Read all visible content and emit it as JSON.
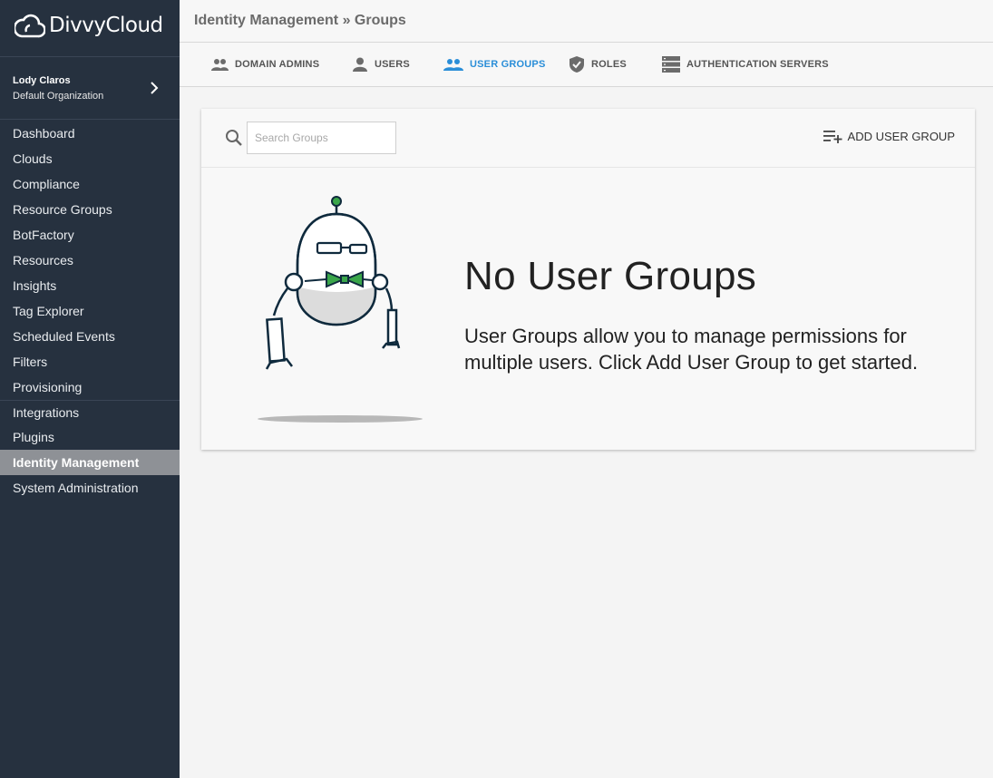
{
  "brand": {
    "name": "DivvyCloud"
  },
  "user": {
    "name": "Lody Claros",
    "org": "Default Organization"
  },
  "nav": {
    "items": [
      {
        "label": "Dashboard"
      },
      {
        "label": "Clouds"
      },
      {
        "label": "Compliance"
      },
      {
        "label": "Resource Groups"
      },
      {
        "label": "BotFactory"
      },
      {
        "label": "Resources"
      },
      {
        "label": "Insights"
      },
      {
        "label": "Tag Explorer"
      },
      {
        "label": "Scheduled Events"
      },
      {
        "label": "Filters"
      },
      {
        "label": "Provisioning"
      },
      {
        "label": "Integrations"
      },
      {
        "label": "Plugins"
      },
      {
        "label": "Identity Management"
      },
      {
        "label": "System Administration"
      }
    ],
    "active": "Identity Management"
  },
  "header": {
    "breadcrumb": "Identity Management » Groups"
  },
  "tabs": [
    {
      "label": "DOMAIN ADMINS",
      "icon": "domain-admins-icon"
    },
    {
      "label": "USERS",
      "icon": "user-icon"
    },
    {
      "label": "USER GROUPS",
      "icon": "user-groups-icon",
      "active": true
    },
    {
      "label": "ROLES",
      "icon": "shield-icon"
    },
    {
      "label": "AUTHENTICATION SERVERS",
      "icon": "server-icon"
    }
  ],
  "search": {
    "placeholder": "Search Groups",
    "value": ""
  },
  "toolbar": {
    "add_label": "ADD USER GROUP"
  },
  "empty_state": {
    "title": "No User Groups",
    "description": "User Groups allow you to manage permissions for multiple users. Click Add User Group to get started."
  },
  "colors": {
    "sidebar": "#26313f",
    "accent": "#2a8ed8",
    "bowtie": "#3aa64a"
  }
}
